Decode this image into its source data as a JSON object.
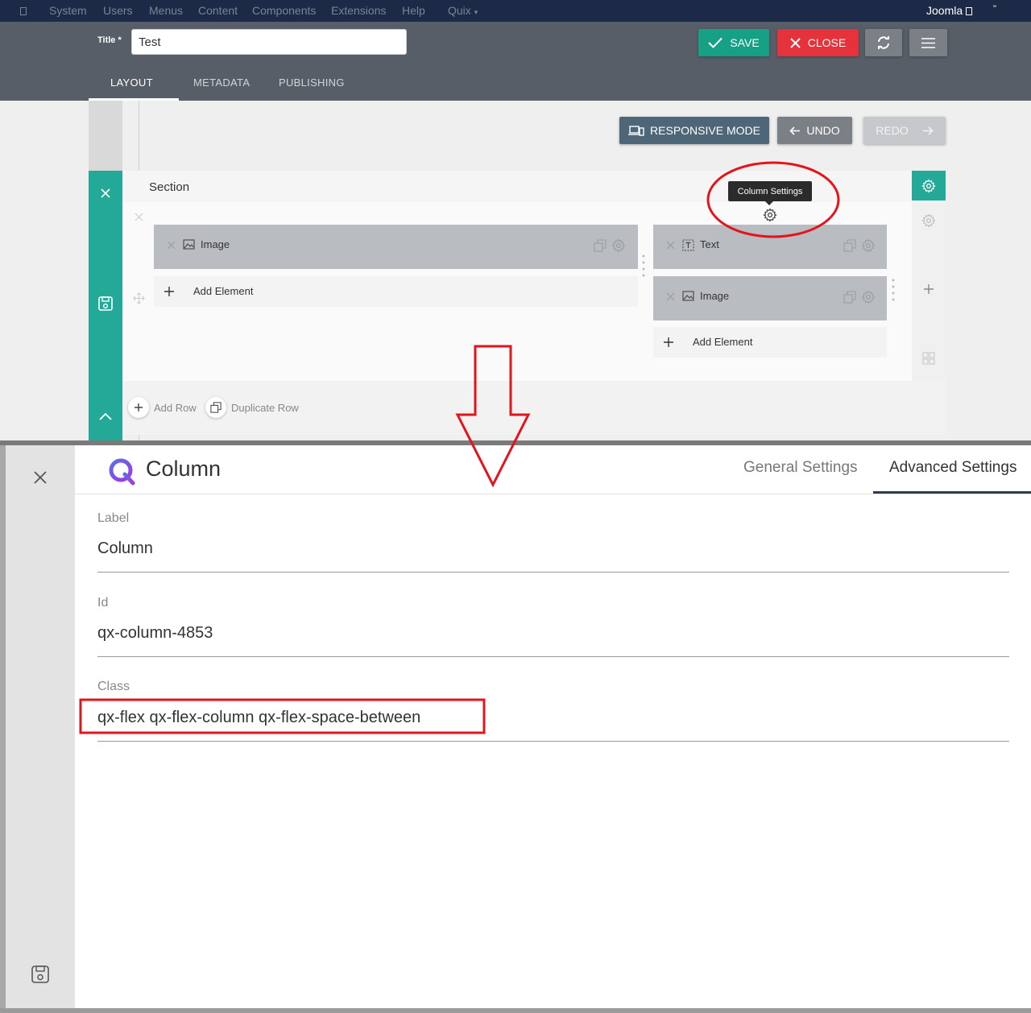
{
  "topbar": {
    "items": [
      "System",
      "Users",
      "Menus",
      "Content",
      "Components",
      "Extensions",
      "Help",
      "Quix"
    ],
    "site_name": "Joomla",
    "more": "\""
  },
  "toolbar": {
    "title_label": "Title *",
    "title_value": "Test",
    "save_label": "SAVE",
    "close_label": "CLOSE"
  },
  "tabs": [
    {
      "label": "LAYOUT",
      "active": true
    },
    {
      "label": "METADATA",
      "active": false
    },
    {
      "label": "PUBLISHING",
      "active": false
    }
  ],
  "builder": {
    "responsive_label": "RESPONSIVE MODE",
    "undo_label": "UNDO",
    "redo_label": "REDO",
    "section_title": "Section",
    "tooltip": "Column Settings",
    "col1": {
      "element": "Image",
      "add": "Add Element"
    },
    "col2": {
      "elements": [
        "Text",
        "Image"
      ],
      "add": "Add Element"
    },
    "add_row": "Add Row",
    "duplicate_row": "Duplicate Row"
  },
  "panel": {
    "title": "Column",
    "tabs": [
      "General Settings",
      "Advanced Settings"
    ],
    "active_tab": "Advanced Settings",
    "fields": [
      {
        "label": "Label",
        "value": "Column"
      },
      {
        "label": "Id",
        "value": "qx-column-4853"
      },
      {
        "label": "Class",
        "value": "qx-flex qx-flex-column qx-flex-space-between"
      }
    ]
  },
  "colors": {
    "teal": "#24a999",
    "save": "#16a085",
    "close": "#e6333b",
    "annotation": "#e3141b",
    "navy": "#1c2a48"
  },
  "icons": [
    "check-icon",
    "close-icon",
    "sync-icon",
    "menu-icon",
    "responsive-icon",
    "arrow-left-icon",
    "arrow-right-icon",
    "gear-icon",
    "image-icon",
    "text-icon",
    "copy-icon",
    "plus-icon",
    "move-icon",
    "save-icon",
    "chevron-up-icon",
    "grid-icon",
    "drag-handle-icon",
    "quix-logo"
  ]
}
